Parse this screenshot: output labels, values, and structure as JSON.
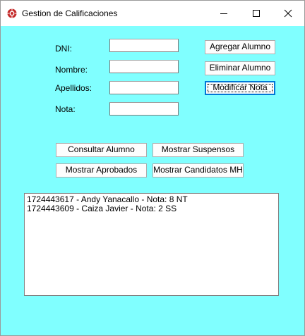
{
  "window": {
    "title": "Gestion de Calificaciones",
    "app_icon": "app-icon"
  },
  "form": {
    "fields": [
      {
        "label": "DNI:",
        "value": ""
      },
      {
        "label": "Nombre:",
        "value": ""
      },
      {
        "label": "Apellidos:",
        "value": ""
      },
      {
        "label": "Nota:",
        "value": ""
      }
    ]
  },
  "actions": {
    "agregar": "Agregar Alumno",
    "eliminar": "Eliminar Alumno",
    "modificar": "Modificar Nota",
    "consultar": "Consultar Alumno",
    "suspensos": "Mostrar Suspensos",
    "aprobados": "Mostrar Aprobados",
    "candidatos": "Mostrar Candidatos MH"
  },
  "results": {
    "items": [
      "1724443617 - Andy Yanacallo - Nota: 8 NT",
      "1724443609 - Caiza Javier - Nota: 2 SS"
    ]
  },
  "colors": {
    "client_background": "#80ffff",
    "focus_border": "#0078d7"
  }
}
